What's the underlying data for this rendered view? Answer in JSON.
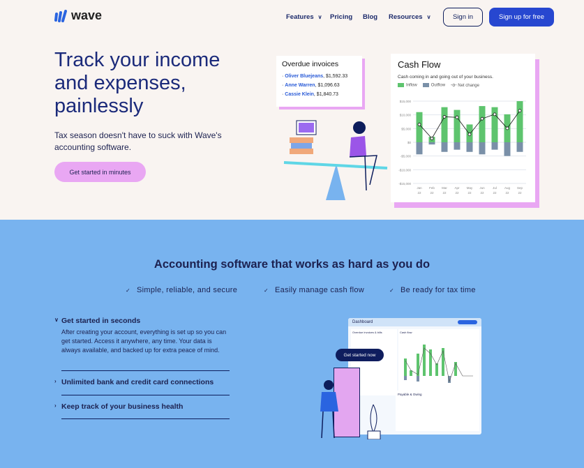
{
  "nav": {
    "brand": "wave",
    "items": [
      "Features",
      "Pricing",
      "Blog",
      "Resources"
    ],
    "sign_in": "Sign in",
    "sign_up": "Sign up for free"
  },
  "hero": {
    "title": "Track your income and expenses, painlessly",
    "subtitle": "Tax season doesn't have to suck with Wave's accounting software.",
    "cta": "Get started in minutes"
  },
  "overdue": {
    "title": "Overdue invoices",
    "items": [
      {
        "name": "Oliver Bluejeans",
        "amount": ", $1,592.33"
      },
      {
        "name": "Anne Warren",
        "amount": ", $1,096.63"
      },
      {
        "name": "Cassie Klein",
        "amount": ", $1,840.73"
      }
    ]
  },
  "chart_data": {
    "type": "bar",
    "title": "Cash Flow",
    "subtitle": "Cash coming in and going out of your business.",
    "categories": [
      "Jan 22",
      "Feb 22",
      "Mar 22",
      "Apr 22",
      "May 22",
      "Jun 22",
      "Jul 22",
      "Aug 22",
      "Sep 22"
    ],
    "series": [
      {
        "name": "Inflow",
        "values": [
          11000,
          2000,
          12800,
          11800,
          6500,
          13200,
          12800,
          10200,
          15000
        ]
      },
      {
        "name": "Outflow",
        "values": [
          -4400,
          -800,
          -3500,
          -2700,
          -3500,
          -4400,
          -2700,
          -5000,
          -3500
        ]
      },
      {
        "name": "Net change",
        "values": [
          6500,
          1400,
          9300,
          9100,
          2900,
          8600,
          10200,
          5100,
          11500
        ]
      }
    ],
    "yticks": [
      "$15,000",
      "$10,000",
      "$5,000",
      "$0",
      "-$5,000",
      "-$10,000",
      "-$15,000"
    ],
    "ylim": [
      -15000,
      15000
    ],
    "grid": true,
    "colors": {
      "inflow": "#5ec46e",
      "outflow": "#7a90a8",
      "net": "#111111"
    }
  },
  "section": {
    "title": "Accounting software that works as hard as you do",
    "features": [
      "Simple, reliable, and secure",
      "Easily manage cash flow",
      "Be ready for tax time"
    ],
    "accordion": [
      {
        "title": "Get started in seconds",
        "body": "After creating your account, everything is set up so you can get started. Access it anywhere, any time. Your data is always available, and backed up for extra peace of mind."
      },
      {
        "title": "Unlimited bank and credit card connections"
      },
      {
        "title": "Keep track of your business health"
      }
    ],
    "dashboard": {
      "title": "Dashboard",
      "cta": "Get started now",
      "panel1": "Overdue invoices & bills",
      "panel2": "Cash flow",
      "panel3": "Payable & Owing"
    }
  }
}
